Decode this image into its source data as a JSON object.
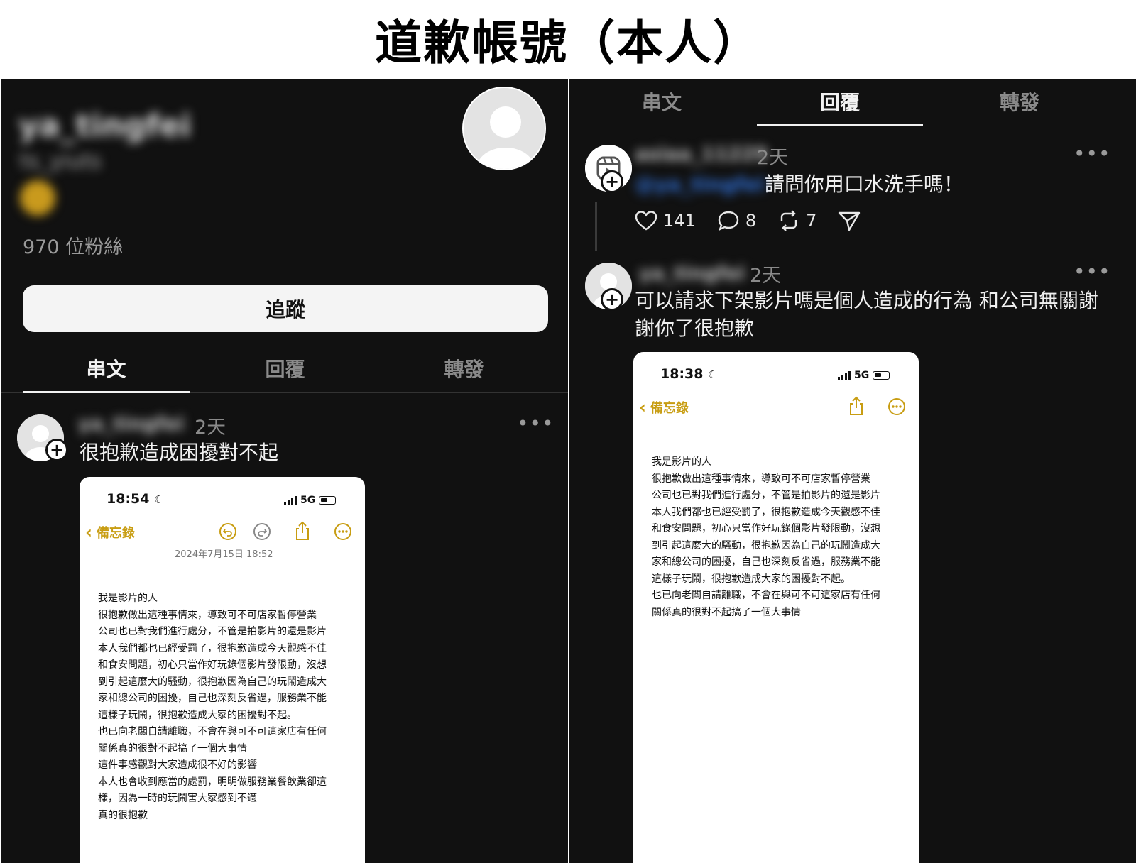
{
  "heading": "道歉帳號（本人）",
  "left": {
    "profile": {
      "name": "ya_tingfei",
      "handle": "ts_yiuts",
      "followers": "970 位粉絲",
      "follow_label": "追蹤"
    },
    "tabs": [
      {
        "label": "串文",
        "active": true
      },
      {
        "label": "回覆",
        "active": false
      },
      {
        "label": "轉發",
        "active": false
      }
    ],
    "post": {
      "username": "ya_tingfei",
      "time": "2天",
      "more": "•••",
      "text": "很抱歉造成困擾對不起",
      "screenshot": {
        "status_time": "18:54",
        "network": "5G",
        "back_label": "備忘錄",
        "date": "2024年7月15日 18:52",
        "body": "我是影片的人\n很抱歉做出這種事情來，導致可不可店家暫停營業\n公司也已對我們進行處分，不管是拍影片的還是影片\n本人我們都也已經受罰了，很抱歉造成今天觀感不佳\n和食安問題，初心只當作好玩錄個影片發限動，沒想\n到引起這麼大的騷動，很抱歉因為自己的玩鬧造成大\n家和總公司的困擾，自己也深刻反省過，服務業不能\n這樣子玩鬧，很抱歉造成大家的困擾對不起。\n也已向老闆自請離職，不會在與可不可這家店有任何\n關係真的很對不起搞了一個大事情\n這件事感觀對大家造成很不好的影響\n本人也會收到應當的處罰，明明做服務業餐飲業卻這\n樣，因為一時的玩鬧害大家感到不適\n真的很抱歉"
      }
    }
  },
  "right": {
    "tabs": [
      {
        "label": "串文",
        "active": false
      },
      {
        "label": "回覆",
        "active": true
      },
      {
        "label": "轉發",
        "active": false
      }
    ],
    "reply_parent": {
      "username": "asiaa_11229",
      "time": "2天",
      "more": "•••",
      "mention": "@ya_tingfei",
      "text": "請問你用口水洗手嗎！",
      "likes": "141",
      "comments": "8",
      "reposts": "7"
    },
    "reply": {
      "username": "ya_tingfei",
      "time": "2天",
      "more": "•••",
      "text": "可以請求下架影片嗎是個人造成的行為 和公司無關謝謝你了很抱歉",
      "screenshot": {
        "status_time": "18:38",
        "network": "5G",
        "back_label": "備忘錄",
        "body": "我是影片的人\n很抱歉做出這種事情來，導致可不可店家暫停營業\n公司也已對我們進行處分，不管是拍影片的還是影片\n本人我們都也已經受罰了，很抱歉造成今天觀感不佳\n和食安問題，初心只當作好玩錄個影片發限動，沒想\n到引起這麼大的騷動，很抱歉因為自己的玩鬧造成大\n家和總公司的困擾，自己也深刻反省過，服務業不能\n這樣子玩鬧，很抱歉造成大家的困擾對不起。\n也已向老闆自請離職，不會在與可不可這家店有任何\n關係真的很對不起搞了一個大事情"
      }
    }
  },
  "colors": {
    "background": "#111111",
    "notes_accent": "#c89d12",
    "mention": "#2f6fd6"
  },
  "icons": [
    "avatar-placeholder-icon",
    "plus-icon",
    "more-icon",
    "heart-icon",
    "comment-icon",
    "repost-icon",
    "send-icon",
    "moon-icon",
    "signal-icon",
    "battery-icon",
    "chevron-left-icon",
    "undo-icon",
    "redo-icon",
    "share-icon",
    "ellipsis-circle-icon",
    "reels-icon"
  ]
}
